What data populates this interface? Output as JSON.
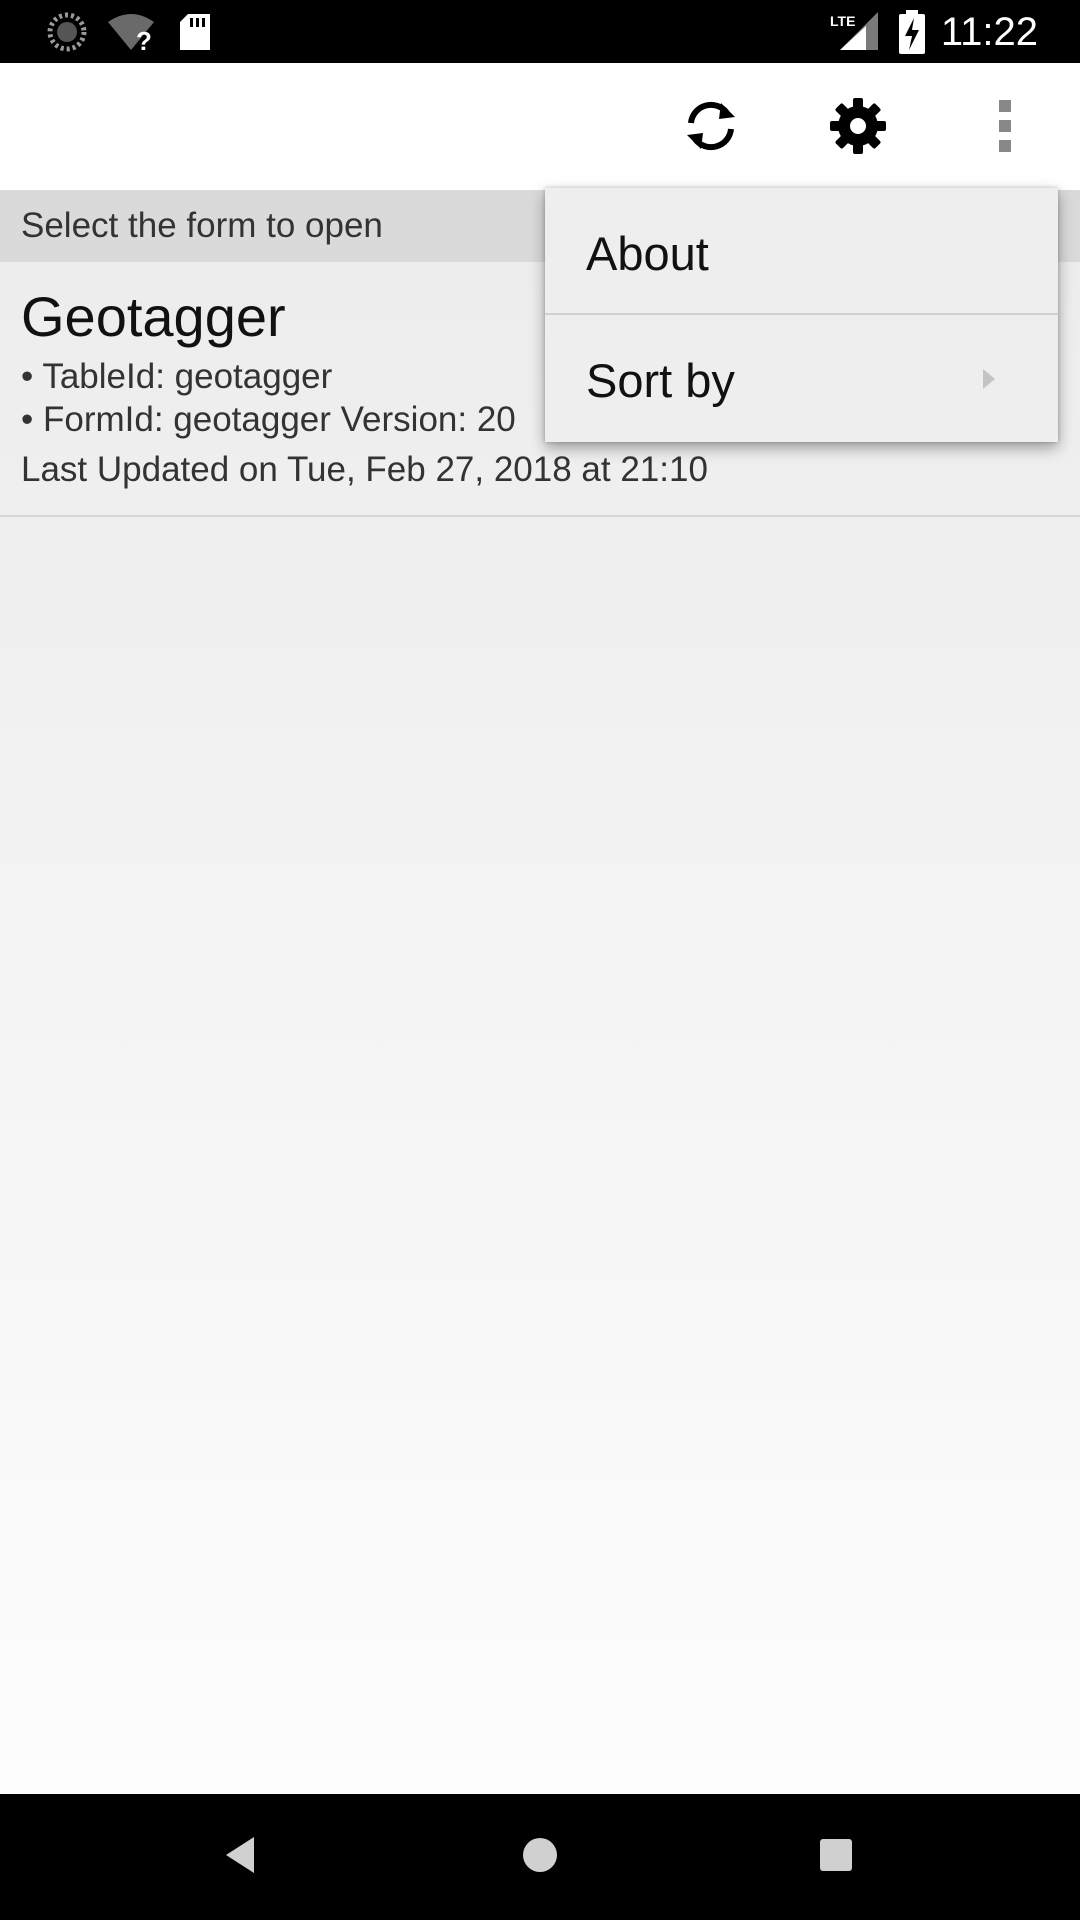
{
  "status_bar": {
    "time": "11:22",
    "icons": [
      "loading-circle-icon",
      "wifi-unknown-icon",
      "sd-card-icon",
      "lte-signal-icon",
      "battery-charging-icon"
    ],
    "network_label": "LTE"
  },
  "app_bar": {
    "actions": [
      "sync-icon",
      "settings-gear-icon",
      "overflow-menu-icon"
    ]
  },
  "subheader": {
    "text": "Select the form to open"
  },
  "forms": [
    {
      "title": "Geotagger",
      "table_id": "• TableId: geotagger",
      "form_id": "• FormId: geotagger Version: 20",
      "last_updated": "Last Updated on Tue, Feb 27, 2018 at 21:10"
    }
  ],
  "overflow_menu": {
    "items": [
      {
        "label": "About",
        "has_submenu": false
      },
      {
        "label": "Sort by",
        "has_submenu": true
      }
    ]
  },
  "nav_bar": {
    "buttons": [
      "back-icon",
      "home-icon",
      "recents-icon"
    ]
  },
  "colors": {
    "status_bar_bg": "#000000",
    "app_bar_bg": "#ffffff",
    "subheader_bg": "#dadada",
    "menu_bg": "#eeeeee"
  }
}
